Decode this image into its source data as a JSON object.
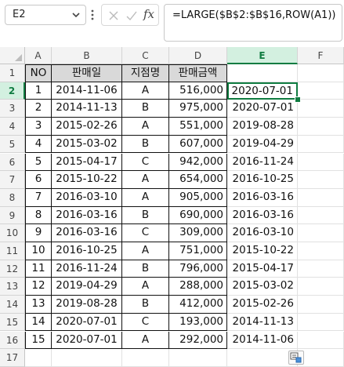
{
  "formula_bar": {
    "name_box": "E2",
    "fx_label": "fx",
    "formula": "=LARGE($B$2:$B$16,ROW(A1))"
  },
  "columns": [
    "A",
    "B",
    "C",
    "D",
    "E",
    "F"
  ],
  "active_column": "E",
  "rows": [
    "1",
    "2",
    "3",
    "4",
    "5",
    "6",
    "7",
    "8",
    "9",
    "10",
    "11",
    "12",
    "13",
    "14",
    "15",
    "16",
    "17"
  ],
  "active_row": "2",
  "table": {
    "headers": [
      "NO",
      "판매일",
      "지점명",
      "판매금액"
    ],
    "records": [
      [
        "1",
        "2014-11-06",
        "A",
        "516,000"
      ],
      [
        "2",
        "2014-11-13",
        "B",
        "975,000"
      ],
      [
        "3",
        "2015-02-26",
        "A",
        "551,000"
      ],
      [
        "4",
        "2015-03-02",
        "B",
        "607,000"
      ],
      [
        "5",
        "2015-04-17",
        "C",
        "942,000"
      ],
      [
        "6",
        "2015-10-22",
        "A",
        "654,000"
      ],
      [
        "7",
        "2016-03-10",
        "A",
        "905,000"
      ],
      [
        "8",
        "2016-03-16",
        "B",
        "690,000"
      ],
      [
        "9",
        "2016-03-16",
        "C",
        "309,000"
      ],
      [
        "10",
        "2016-10-25",
        "A",
        "751,000"
      ],
      [
        "11",
        "2016-11-24",
        "B",
        "796,000"
      ],
      [
        "12",
        "2019-04-29",
        "A",
        "288,000"
      ],
      [
        "13",
        "2019-08-28",
        "B",
        "412,000"
      ],
      [
        "14",
        "2020-07-01",
        "C",
        "193,000"
      ],
      [
        "15",
        "2020-07-01",
        "A",
        "292,000"
      ]
    ]
  },
  "results_col_E": [
    "2020-07-01",
    "2020-07-01",
    "2019-08-28",
    "2019-04-29",
    "2016-11-24",
    "2016-10-25",
    "2016-03-16",
    "2016-03-16",
    "2016-03-10",
    "2015-10-22",
    "2015-04-17",
    "2015-03-02",
    "2015-02-26",
    "2014-11-13",
    "2014-11-06"
  ],
  "colors": {
    "accent_green": "#107c41",
    "header_fill": "#d9d9d9"
  }
}
